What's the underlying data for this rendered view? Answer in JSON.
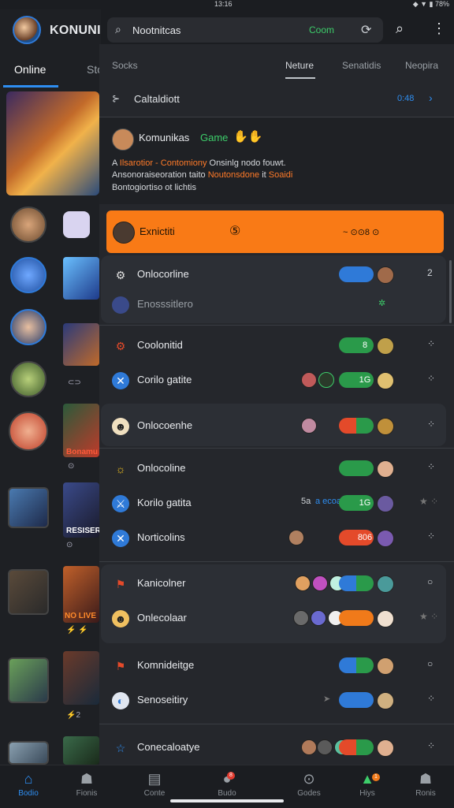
{
  "status_bar": {
    "time": "13:16",
    "right": "◆ ▼ ▮ 78%"
  },
  "app": {
    "title": "KONUNI"
  },
  "left_tabs": {
    "active": "Online",
    "other": "Sto"
  },
  "left_captions": [
    "⊂⊃",
    "Bonamu",
    "⊙",
    "RESISER",
    "⊙",
    "NO LIVE",
    "⚡ ⚡",
    "⚡2"
  ],
  "search": {
    "placeholder": "Nootnitcas",
    "badge": "Coom"
  },
  "panel_tabs": [
    "Socks",
    "Neture",
    "Senatidis",
    "Neopira"
  ],
  "section": {
    "icon": "⊱",
    "title": "Caltaldiott",
    "count": "0:48",
    "arrow": "›"
  },
  "post": {
    "name": "Komunikas",
    "game": "Game",
    "emoji": "✋✋",
    "line1_a": "A ",
    "line1_orange": "Ilsarotior - Contomiony",
    "line1_b": " Onsinlg nodo fouwt.",
    "line2_a": "Ansonoraiseoration taito ",
    "line2_orange": "Noutonsdone",
    "line2_b": " it ",
    "line2_orange2": "Soaidi",
    "line3": "Bontogiortiso ot lichtis"
  },
  "banner": {
    "title": "Exnictiti",
    "icon": "⑤",
    "suffix": "~ ⊙⊙8 ⊙"
  },
  "rows": [
    {
      "label": "Onlocorline",
      "extra": "",
      "more": "2"
    },
    {
      "label": "Enosssitlero",
      "extra": "",
      "more": ""
    },
    {
      "label": "Coolonitid",
      "extra": "",
      "more": "⁘"
    },
    {
      "label": "Corilo gatite",
      "extra": "",
      "more": "⁘"
    },
    {
      "label": "Onlocoenhe",
      "extra": "",
      "more": "⁘"
    },
    {
      "label": "Onlocoline",
      "extra": "",
      "more": "⁘"
    },
    {
      "label": "Korilo gatita",
      "extra": "5a",
      "extra2": "a ecoa",
      "more": "⁘"
    },
    {
      "label": "Norticolins",
      "extra": "",
      "more": "⁘"
    },
    {
      "label": "Kanicolner",
      "extra": "",
      "more": "○"
    },
    {
      "label": "Onlecolaar",
      "extra": "",
      "more": "⁘"
    },
    {
      "label": "Komnideitge",
      "extra": "",
      "more": "○"
    },
    {
      "label": "Senoseitiry",
      "extra": "",
      "more": "⁘"
    },
    {
      "label": "Conecaloatye",
      "extra": "",
      "more": "⁘"
    }
  ],
  "pill_texts": [
    "",
    "",
    "8",
    "1G",
    "",
    "",
    "1G",
    "806",
    "",
    "",
    "",
    "",
    ""
  ],
  "pill_colors": [
    [
      "#2f7ad8",
      "#2f7ad8"
    ],
    [
      "#2a2c31",
      "#2a2c31"
    ],
    [
      "#2a9a4a",
      "#2a9a4a"
    ],
    [
      "#2a9a4a",
      "#2a9a4a"
    ],
    [
      "#e44a2a",
      "#2a9a4a"
    ],
    [
      "#2a9a4a",
      "#2a9a4a"
    ],
    [
      "#2a9a4a",
      "#2a9a4a"
    ],
    [
      "#e44a2a",
      "#e44a2a"
    ],
    [
      "#2f7ad8",
      "#2a9a4a"
    ],
    [
      "#f07a1a",
      "#f07a1a"
    ],
    [
      "#2f7ad8",
      "#2a9a4a"
    ],
    [
      "#2f7ad8",
      "#2f7ad8"
    ],
    [
      "#e44a2a",
      "#2a9a4a"
    ]
  ],
  "bottom_nav": [
    {
      "icon": "⌂",
      "label": "Bodio",
      "active": true
    },
    {
      "icon": "☗",
      "label": "Fionis",
      "active": false
    },
    {
      "icon": "▤",
      "label": "Conte",
      "active": false
    },
    {
      "icon": "●",
      "label": "Budo",
      "active": false,
      "badge": "8"
    },
    {
      "icon": "⊙",
      "label": "Godes",
      "active": false
    },
    {
      "icon": "▲",
      "label": "Hiys",
      "active": false,
      "badge": "1"
    },
    {
      "icon": "☗",
      "label": "Ronis",
      "active": false
    }
  ],
  "colors": {
    "accent": "#2e8df0",
    "banner": "#f97a16",
    "green": "#3dcd6a"
  }
}
